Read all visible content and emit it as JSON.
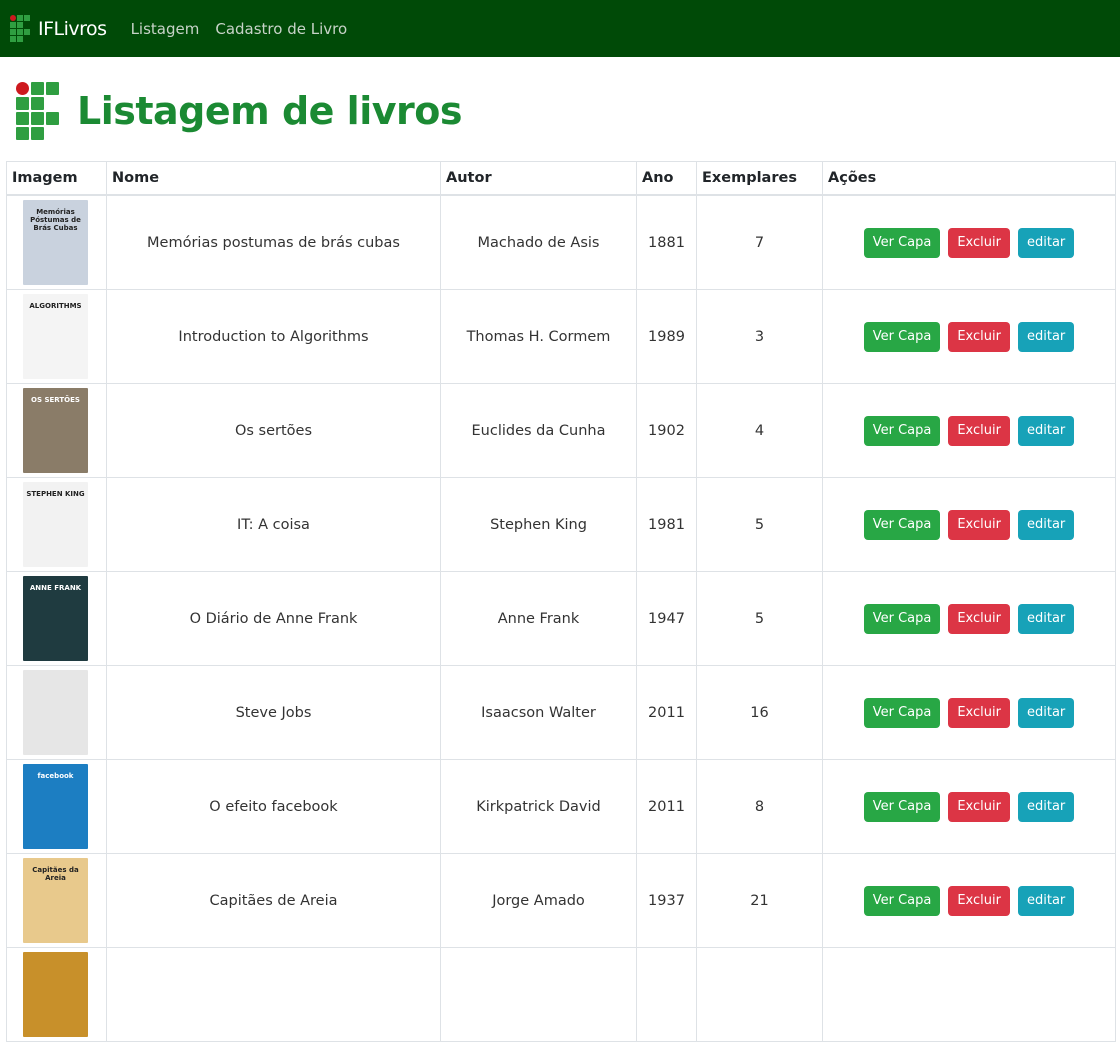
{
  "nav": {
    "brand": "IFLivros",
    "links": [
      "Listagem",
      "Cadastro de Livro"
    ]
  },
  "page": {
    "title": "Listagem de livros"
  },
  "table": {
    "headers": [
      "Imagem",
      "Nome",
      "Autor",
      "Ano",
      "Exemplares",
      "Ações"
    ],
    "actions": {
      "view": "Ver Capa",
      "delete": "Excluir",
      "edit": "editar"
    },
    "rows": [
      {
        "nome": "Memórias postumas de brás cubas",
        "autor": "Machado de Asis",
        "ano": "1881",
        "exemplares": "7",
        "cover_text": "Memórias Póstumas de Brás Cubas",
        "cover_bg": "#c9d2de"
      },
      {
        "nome": "Introduction to Algorithms",
        "autor": "Thomas H. Cormem",
        "ano": "1989",
        "exemplares": "3",
        "cover_text": "ALGORITHMS",
        "cover_bg": "#f4f4f4"
      },
      {
        "nome": "Os sertões",
        "autor": "Euclides da Cunha",
        "ano": "1902",
        "exemplares": "4",
        "cover_text": "OS SERTÕES",
        "cover_bg": "#8a7c68"
      },
      {
        "nome": "IT: A coisa",
        "autor": "Stephen King",
        "ano": "1981",
        "exemplares": "5",
        "cover_text": "STEPHEN KING",
        "cover_bg": "#f2f2f2"
      },
      {
        "nome": "O Diário de Anne Frank",
        "autor": "Anne Frank",
        "ano": "1947",
        "exemplares": "5",
        "cover_text": "ANNE FRANK",
        "cover_bg": "#1f3b40"
      },
      {
        "nome": "Steve Jobs",
        "autor": "Isaacson Walter",
        "ano": "2011",
        "exemplares": "16",
        "cover_text": "",
        "cover_bg": "#e6e6e6"
      },
      {
        "nome": "O efeito facebook",
        "autor": "Kirkpatrick David",
        "ano": "2011",
        "exemplares": "8",
        "cover_text": "facebook",
        "cover_bg": "#1c7ec2"
      },
      {
        "nome": "Capitães de Areia",
        "autor": "Jorge Amado",
        "ano": "1937",
        "exemplares": "21",
        "cover_text": "Capitães da Areia",
        "cover_bg": "#e8c98c"
      },
      {
        "nome": "",
        "autor": "",
        "ano": "",
        "exemplares": "",
        "cover_text": "",
        "cover_bg": "#c8902a"
      }
    ]
  },
  "colors": {
    "navbar": "#004a07",
    "title": "#1b8a33",
    "success": "#28a745",
    "danger": "#dc3545",
    "info": "#17a2b8"
  }
}
